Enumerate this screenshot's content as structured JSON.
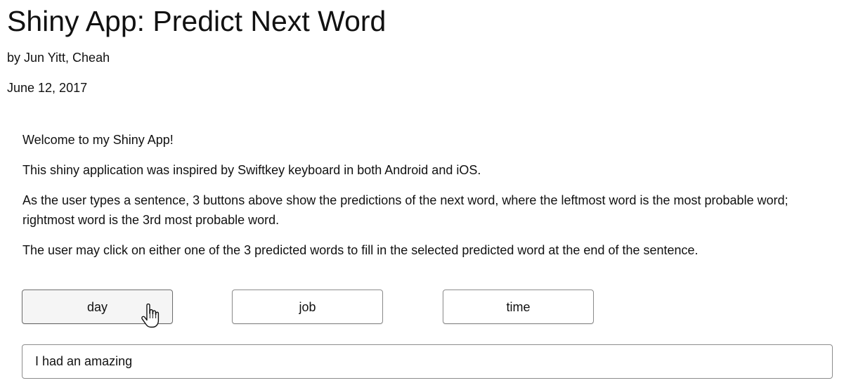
{
  "header": {
    "title": "Shiny App: Predict Next Word",
    "author": "by Jun Yitt, Cheah",
    "date": "June 12, 2017"
  },
  "intro": {
    "welcome": "Welcome to my Shiny App!",
    "inspiration": "This shiny application was inspired by Swiftkey keyboard in both Android and iOS.",
    "explanation": "As the user types a sentence, 3 buttons above show the predictions of the next word, where the leftmost word is the most probable word; rightmost word is the 3rd most probable word.",
    "instruction": "The user may click on either one of the 3 predicted words to fill in the selected predicted word at the end of the sentence."
  },
  "predictions": {
    "word1": "day",
    "word2": "job",
    "word3": "time"
  },
  "sentence_input": {
    "value": "I had an amazing"
  },
  "cursor": {
    "icon": "hand-pointer-icon"
  }
}
